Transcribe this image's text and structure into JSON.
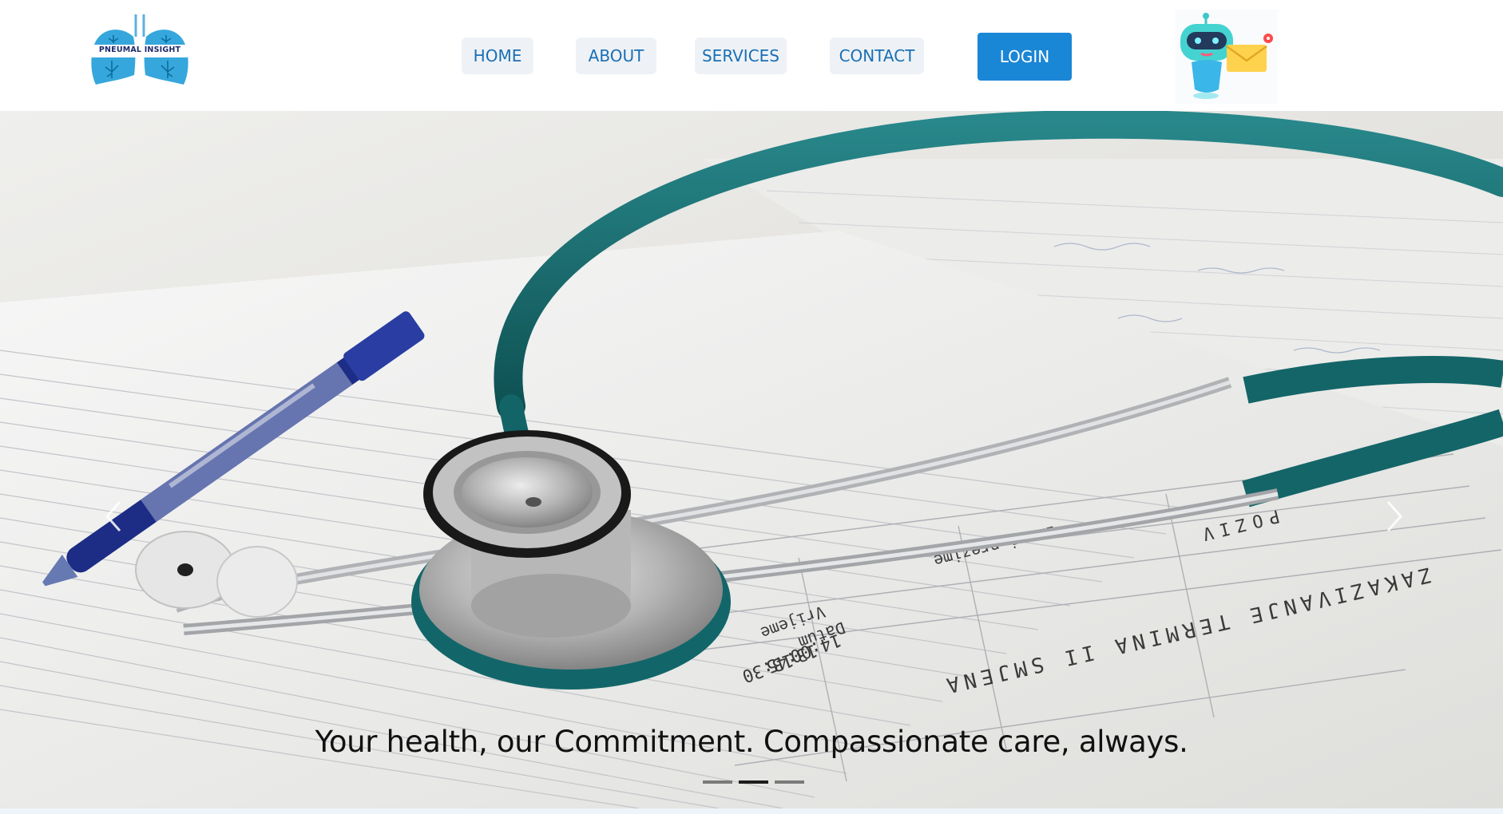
{
  "brand": {
    "logo_text": "PNEUMAL INSIGHT",
    "logo_icon": "lungs-icon"
  },
  "nav": {
    "items": [
      {
        "label": "HOME"
      },
      {
        "label": "ABOUT"
      },
      {
        "label": "SERVICES"
      },
      {
        "label": "CONTACT"
      }
    ],
    "login_label": "LOGIN"
  },
  "chatbot": {
    "icon": "robot-chat-icon"
  },
  "hero": {
    "caption": "Your health, our Commitment. Compassionate care, always.",
    "prev_icon": "chevron-left-icon",
    "next_icon": "chevron-right-icon",
    "slide_count": 3,
    "active_slide": 2,
    "image_subject": "stethoscope-and-pen-on-medical-form",
    "form_text": {
      "heading": "ZAKAZIVANJE TERMINA II SMJENA",
      "datum": "Datum",
      "vrijeme": "Vrijeme",
      "times": [
        "14:00",
        "13:45",
        "13:30"
      ],
      "ime": "Ime i prezime",
      "poziv": "POZIV"
    }
  },
  "colors": {
    "accent": "#1a86d6",
    "nav_text": "#1a6fb5",
    "nav_bg": "#eef2f6",
    "tubing": "#1a6f72"
  }
}
